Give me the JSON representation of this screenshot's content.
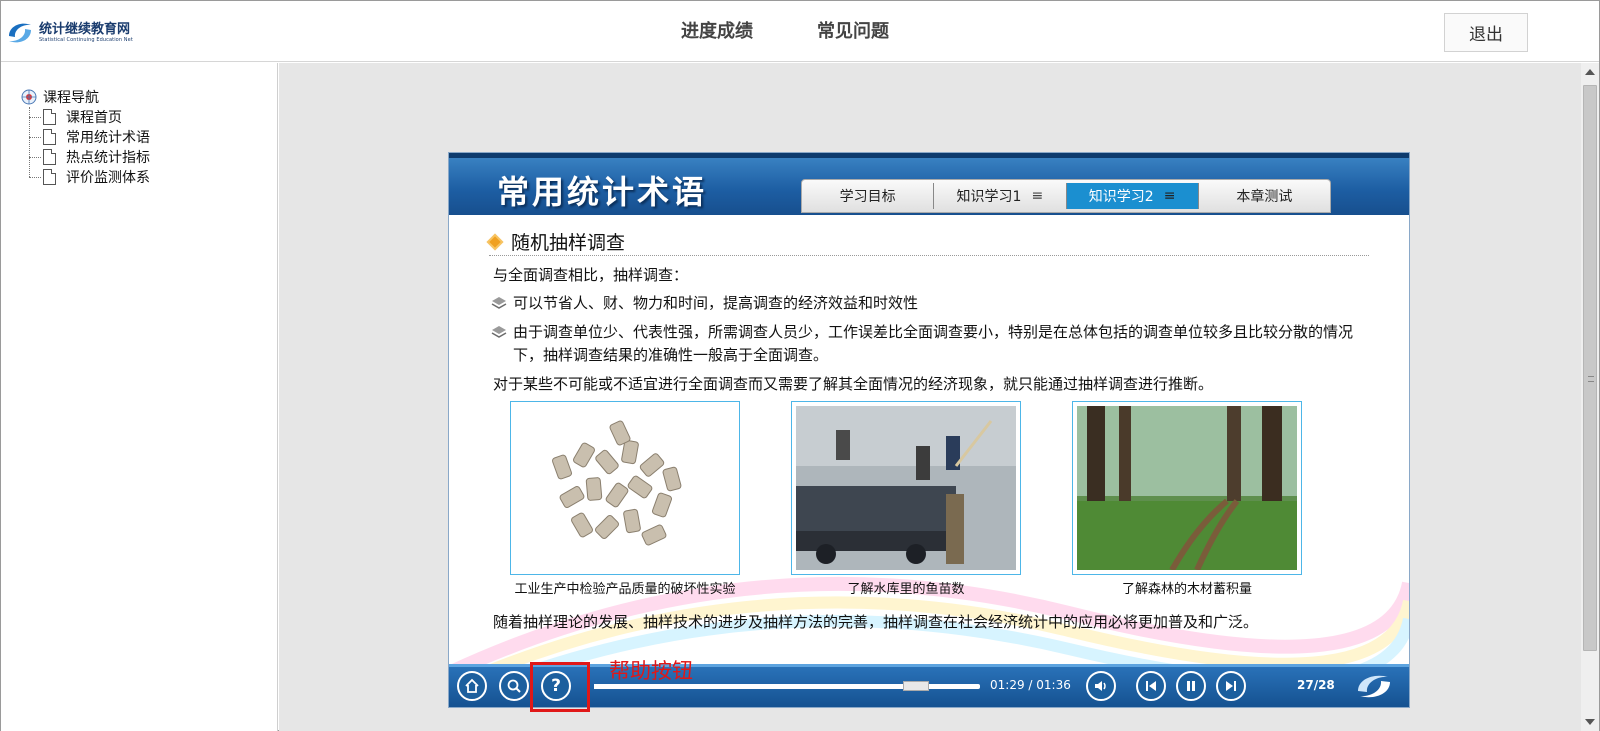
{
  "header": {
    "logo_cn": "统计继续教育网",
    "logo_en": "Statistical Continuing Education Net",
    "nav": [
      "进度成绩",
      "常见问题"
    ],
    "logout": "退出"
  },
  "sidebar": {
    "root": "课程导航",
    "items": [
      "课程首页",
      "常用统计术语",
      "热点统计指标",
      "评价监测体系"
    ]
  },
  "player": {
    "title": "常用统计术语",
    "tabs": [
      {
        "label": "学习目标",
        "menu": false
      },
      {
        "label": "知识学习1",
        "menu": true
      },
      {
        "label": "知识学习2",
        "menu": true,
        "active": true
      },
      {
        "label": "本章测试",
        "menu": false
      }
    ],
    "menu_glyph": "≡",
    "section_title": "随机抽样调查",
    "intro": "与全面调查相比，抽样调查：",
    "bullets": [
      "可以节省人、财、物力和时间，提高调查的经济效益和时效性",
      "由于调查单位少、代表性强，所需调查人员少，工作误差比全面调查要小，特别是在总体包括的调查单位较多且比较分散的情况下，抽样调查结果的准确性一般高于全面调查。"
    ],
    "statement": "对于某些不可能或不适宜进行全面调查而又需要了解其全面情况的经济现象，就只能通过抽样调查进行推断。",
    "images": [
      {
        "caption": "工业生产中检验产品质量的破坏性实验"
      },
      {
        "caption": "了解水库里的鱼苗数"
      },
      {
        "caption": "了解森林的木材蓄积量"
      }
    ],
    "conclusion": "随着抽样理论的发展、抽样技术的进步及抽样方法的完善，抽样调查在社会经济统计中的应用必将更加普及和广泛。",
    "controls": {
      "time": "01:29 / 01:36",
      "progress": 0.93,
      "page": "27/28",
      "help_glyph": "?"
    }
  },
  "annotation": {
    "label": "帮助按钮",
    "color": "#e01818"
  },
  "colors": {
    "title_blue": "#1d5ea3",
    "tab_active": "#1b8fd0",
    "accent_orange": "#f0a020"
  }
}
